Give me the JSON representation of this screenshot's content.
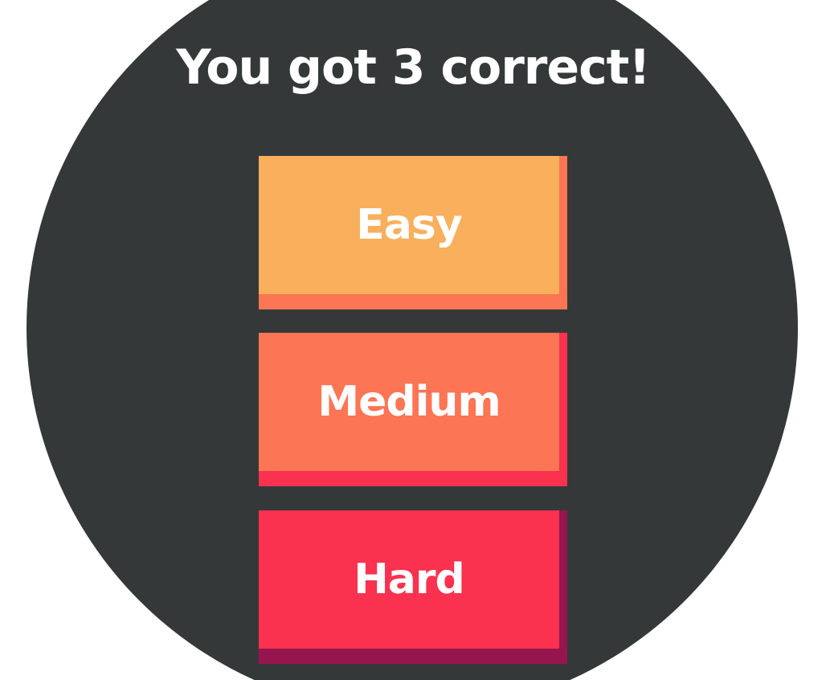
{
  "result": {
    "title": "You got 3 correct!"
  },
  "difficulty_buttons": [
    {
      "label": "Easy",
      "face_color": "#F9AF5B",
      "shadow_color": "#FC7554"
    },
    {
      "label": "Medium",
      "face_color": "#FC7554",
      "shadow_color": "#FA314F"
    },
    {
      "label": "Hard",
      "face_color": "#FA314F",
      "shadow_color": "#97154F"
    }
  ],
  "colors": {
    "background_circle": "#353839",
    "text": "#FFFFFF"
  }
}
